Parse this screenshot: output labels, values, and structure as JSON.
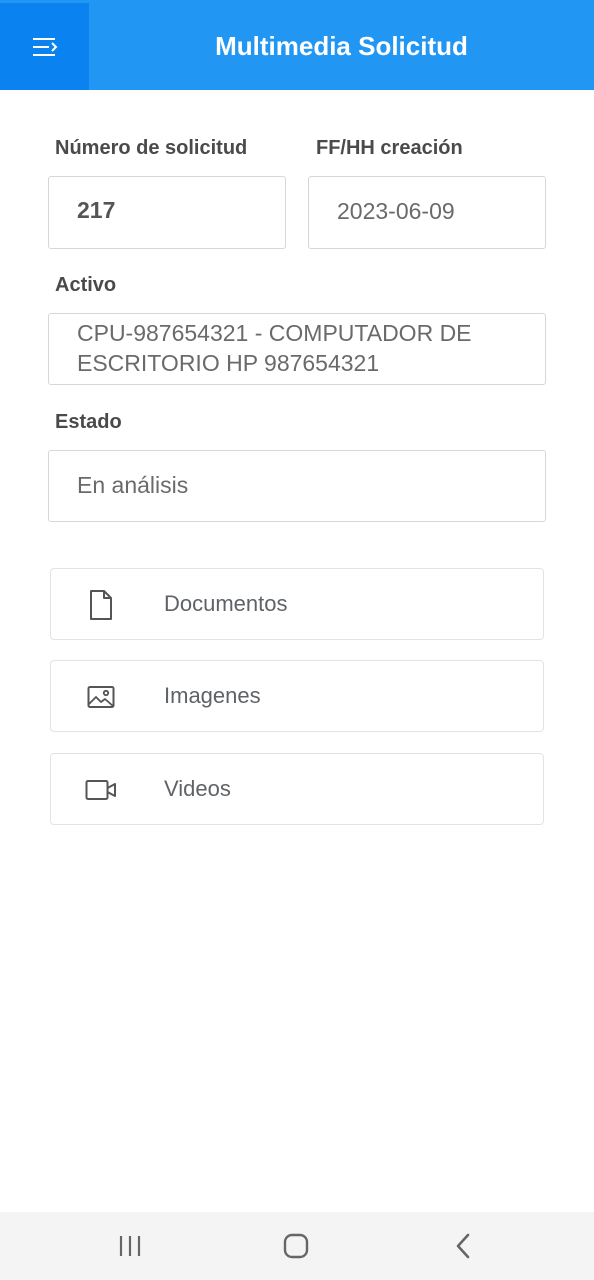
{
  "header": {
    "title": "Multimedia Solicitud",
    "menu_icon": "menu-icon"
  },
  "form": {
    "request_number": {
      "label": "Número de solicitud",
      "value": "217"
    },
    "created_at": {
      "label": "FF/HH creación",
      "value": "2023-06-09"
    },
    "asset": {
      "label": "Activo",
      "value_line1": "CPU-987654321 - COMPUTADOR DE",
      "value_line2": "ESCRITORIO HP 987654321"
    },
    "status": {
      "label": "Estado",
      "value": "En análisis"
    }
  },
  "media": [
    {
      "label": "Documentos",
      "icon": "document-icon"
    },
    {
      "label": "Imagenes",
      "icon": "image-icon"
    },
    {
      "label": "Videos",
      "icon": "video-icon"
    }
  ],
  "system_nav": {
    "icons": [
      "recent-apps-icon",
      "home-icon",
      "back-icon"
    ]
  },
  "colors": {
    "appbar": "#2196f3",
    "menu_button": "#0a82f0"
  }
}
